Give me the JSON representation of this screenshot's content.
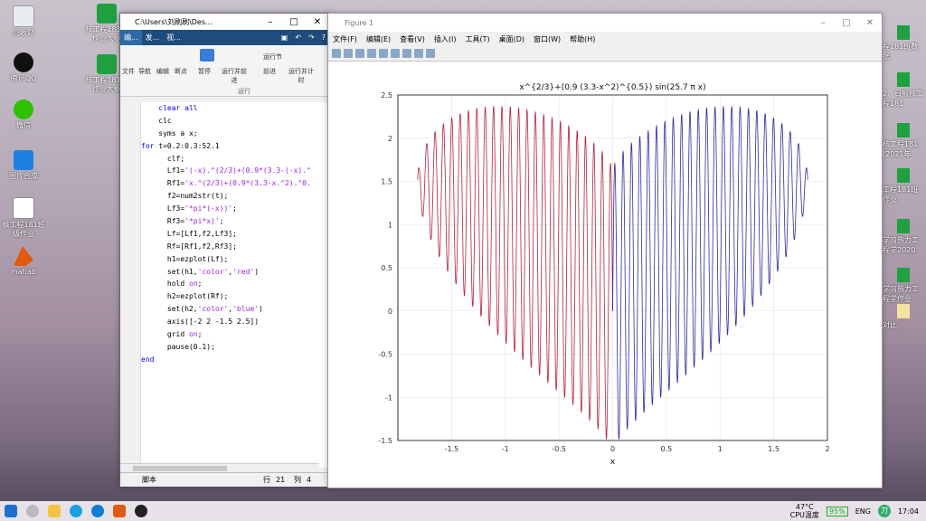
{
  "desktop": {
    "left_icons": [
      {
        "label": "回收站",
        "kind": "bin"
      },
      {
        "label": "腾讯QQ",
        "kind": "qq"
      },
      {
        "label": "微信",
        "kind": "wx"
      },
      {
        "label": "图片合成",
        "kind": "pic"
      },
      {
        "label": "核工程181班级作业",
        "kind": "doc"
      },
      {
        "label": "matlab",
        "kind": "mat"
      }
    ],
    "mid_icons": [
      {
        "label": "核工程181班作业大纲",
        "kind": "green"
      },
      {
        "label": "核工程181班作业大纲",
        "kind": "green"
      }
    ],
    "right_texts": [
      "程181班数据",
      "2、日报核工程181",
      "核工程181 (2021年",
      "工程181班作业",
      "学习热力工程学2020",
      "学习热力工程学作业",
      "对比"
    ]
  },
  "editor": {
    "title": "C:\\Users\\刘刷刷\\Des...",
    "tabs": [
      "编...",
      "发...",
      "视..."
    ],
    "ribbon": {
      "groups": [
        "文件",
        "导航",
        "编辑",
        "断点"
      ],
      "run_buttons": [
        "暂停",
        "运行并前进",
        "运行节",
        "前进",
        "运行并计时"
      ],
      "section_label": "运行"
    },
    "code_lines": [
      [
        {
          "t": "    clear all",
          "c": "kw"
        }
      ],
      [
        {
          "t": "    clc",
          "c": ""
        }
      ],
      [
        {
          "t": "    syms a x;",
          "c": ""
        }
      ],
      [
        {
          "t": "for ",
          "c": "kw"
        },
        {
          "t": "t=0.2:0.3:52.1",
          "c": ""
        }
      ],
      [
        {
          "t": "      clf;",
          "c": ""
        }
      ],
      [
        {
          "t": "      Lf1=",
          "c": ""
        },
        {
          "t": "'(-x).^(2/3)+(0.9*(3.3-(-x).^",
          "c": "str"
        }
      ],
      [
        {
          "t": "      Rf1=",
          "c": ""
        },
        {
          "t": "'x.^(2/3)+(0.9*(3.3-x.^2).^0.",
          "c": "str"
        }
      ],
      [
        {
          "t": "      f2=num2str(t);",
          "c": ""
        }
      ],
      [
        {
          "t": "      Lf3=",
          "c": ""
        },
        {
          "t": "'*pi*(-x))'",
          "c": "str"
        },
        {
          "t": ";",
          "c": ""
        }
      ],
      [
        {
          "t": "      Rf3=",
          "c": ""
        },
        {
          "t": "'*pi*x)'",
          "c": "str"
        },
        {
          "t": ";",
          "c": ""
        }
      ],
      [
        {
          "t": "      Lf=[Lf1,f2,Lf3];",
          "c": ""
        }
      ],
      [
        {
          "t": "      Rf=[Rf1,f2,Rf3];",
          "c": ""
        }
      ],
      [
        {
          "t": "      h1=ezplot(Lf);",
          "c": ""
        }
      ],
      [
        {
          "t": "      set(h1,",
          "c": ""
        },
        {
          "t": "'color'",
          "c": "str"
        },
        {
          "t": ",",
          "c": ""
        },
        {
          "t": "'red'",
          "c": "str"
        },
        {
          "t": ")",
          "c": ""
        }
      ],
      [
        {
          "t": "      hold ",
          "c": ""
        },
        {
          "t": "on",
          "c": "str"
        },
        {
          "t": ";",
          "c": ""
        }
      ],
      [
        {
          "t": "      h2=ezplot(Rf);",
          "c": ""
        }
      ],
      [
        {
          "t": "      set(h2,",
          "c": ""
        },
        {
          "t": "'color'",
          "c": "str"
        },
        {
          "t": ",",
          "c": ""
        },
        {
          "t": "'blue'",
          "c": "str"
        },
        {
          "t": ")",
          "c": ""
        }
      ],
      [
        {
          "t": "      axis([-2 2 -1.5 2.5])",
          "c": ""
        }
      ],
      [
        {
          "t": "      grid ",
          "c": ""
        },
        {
          "t": "on",
          "c": "str"
        },
        {
          "t": ";",
          "c": ""
        }
      ],
      [
        {
          "t": "      pause(0.1);",
          "c": ""
        }
      ],
      [
        {
          "t": "end",
          "c": "kw"
        }
      ]
    ],
    "status": {
      "mode": "脚本",
      "row_label": "行",
      "row": "21",
      "col_label": "列",
      "col": "4"
    }
  },
  "figure": {
    "title": "Figure 1",
    "menus": [
      "文件(F)",
      "编辑(E)",
      "查看(V)",
      "插入(I)",
      "工具(T)",
      "桌面(D)",
      "窗口(W)",
      "帮助(H)"
    ]
  },
  "chart_data": {
    "type": "line",
    "title": "x^{2/3}+(0.9 (3.3-x^2)^{0.5}) sin(25.7 π x)",
    "xlabel": "x",
    "ylabel": "",
    "xlim": [
      -2,
      2
    ],
    "ylim": [
      -1.5,
      2.5
    ],
    "xticks": [
      "-1.5",
      "-1",
      "-0.5",
      "0",
      "0.5",
      "1",
      "1.5",
      "2"
    ],
    "yticks": [
      "2.5",
      "2",
      "1.5",
      "1",
      "0.5",
      "0",
      "-0.5",
      "-1",
      "-1.5"
    ],
    "grid": true,
    "t": 25.7,
    "series": [
      {
        "color": "#b22240",
        "x_range": [
          -1.817,
          0
        ],
        "formula": "(-x)^(2/3)+0.9*sqrt(3.3-x^2)*sin(t*pi*(-x))"
      },
      {
        "color": "#2b2b9a",
        "x_range": [
          0,
          1.817
        ],
        "formula": "x^(2/3)+0.9*sqrt(3.3-x^2)*sin(t*pi*x)"
      }
    ]
  },
  "taskbar": {
    "temp": "47°C",
    "cpu": "CPU温度",
    "battery": "95%",
    "lang": "ENG",
    "user_badge": "刀",
    "time": "17:04"
  }
}
